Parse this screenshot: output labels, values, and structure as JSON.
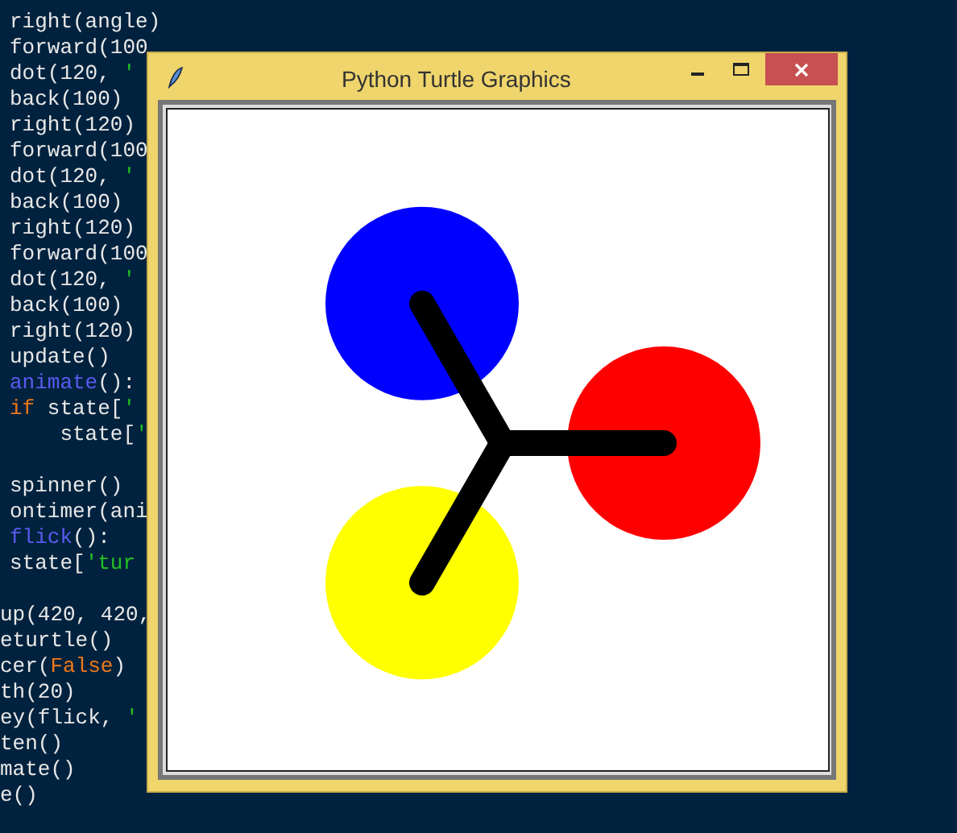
{
  "editor": {
    "lines": [
      {
        "kind": "code",
        "clipped": false,
        "segments": [
          {
            "kind": "plain",
            "text": "right(angle)"
          }
        ]
      },
      {
        "kind": "code",
        "clipped": false,
        "segments": [
          {
            "kind": "plain",
            "text": "forward(100"
          }
        ]
      },
      {
        "kind": "code",
        "clipped": false,
        "segments": [
          {
            "kind": "plain",
            "text": "dot(120, "
          },
          {
            "kind": "string",
            "text": "'"
          }
        ]
      },
      {
        "kind": "code",
        "clipped": false,
        "segments": [
          {
            "kind": "plain",
            "text": "back(100)"
          }
        ]
      },
      {
        "kind": "code",
        "clipped": false,
        "segments": [
          {
            "kind": "plain",
            "text": "right(120)"
          }
        ]
      },
      {
        "kind": "code",
        "clipped": false,
        "segments": [
          {
            "kind": "plain",
            "text": "forward(100"
          }
        ]
      },
      {
        "kind": "code",
        "clipped": false,
        "segments": [
          {
            "kind": "plain",
            "text": "dot(120, "
          },
          {
            "kind": "string",
            "text": "'"
          }
        ]
      },
      {
        "kind": "code",
        "clipped": false,
        "segments": [
          {
            "kind": "plain",
            "text": "back(100)"
          }
        ]
      },
      {
        "kind": "code",
        "clipped": false,
        "segments": [
          {
            "kind": "plain",
            "text": "right(120)"
          }
        ]
      },
      {
        "kind": "code",
        "clipped": false,
        "segments": [
          {
            "kind": "plain",
            "text": "forward(100"
          }
        ]
      },
      {
        "kind": "code",
        "clipped": false,
        "segments": [
          {
            "kind": "plain",
            "text": "dot(120, "
          },
          {
            "kind": "string",
            "text": "'"
          }
        ]
      },
      {
        "kind": "code",
        "clipped": false,
        "segments": [
          {
            "kind": "plain",
            "text": "back(100)"
          }
        ]
      },
      {
        "kind": "code",
        "clipped": false,
        "segments": [
          {
            "kind": "plain",
            "text": "right(120)"
          }
        ]
      },
      {
        "kind": "code",
        "clipped": false,
        "segments": [
          {
            "kind": "plain",
            "text": "update()"
          }
        ]
      },
      {
        "kind": "code",
        "clipped": false,
        "segments": [
          {
            "kind": "function",
            "text": "animate"
          },
          {
            "kind": "plain",
            "text": "():"
          }
        ]
      },
      {
        "kind": "code",
        "clipped": false,
        "segments": [
          {
            "kind": "keyword",
            "text": "if"
          },
          {
            "kind": "plain",
            "text": " state["
          },
          {
            "kind": "string",
            "text": "'"
          }
        ]
      },
      {
        "kind": "code",
        "clipped": false,
        "segments": [
          {
            "kind": "plain",
            "text": "    state["
          },
          {
            "kind": "string",
            "text": "'"
          }
        ]
      },
      {
        "kind": "blank"
      },
      {
        "kind": "code",
        "clipped": false,
        "segments": [
          {
            "kind": "plain",
            "text": "spinner()"
          }
        ]
      },
      {
        "kind": "code",
        "clipped": false,
        "segments": [
          {
            "kind": "plain",
            "text": "ontimer(ani"
          }
        ]
      },
      {
        "kind": "code",
        "clipped": false,
        "segments": [
          {
            "kind": "function",
            "text": "flick"
          },
          {
            "kind": "plain",
            "text": "():"
          }
        ]
      },
      {
        "kind": "code",
        "clipped": false,
        "segments": [
          {
            "kind": "plain",
            "text": "state["
          },
          {
            "kind": "string",
            "text": "'tur"
          }
        ]
      },
      {
        "kind": "blank"
      },
      {
        "kind": "code",
        "clipped": true,
        "segments": [
          {
            "kind": "plain",
            "text": "up(420, 420,"
          }
        ]
      },
      {
        "kind": "code",
        "clipped": true,
        "segments": [
          {
            "kind": "plain",
            "text": "eturtle()"
          }
        ]
      },
      {
        "kind": "code",
        "clipped": true,
        "segments": [
          {
            "kind": "plain",
            "text": "cer("
          },
          {
            "kind": "keyword",
            "text": "False"
          },
          {
            "kind": "plain",
            "text": ")"
          }
        ]
      },
      {
        "kind": "code",
        "clipped": true,
        "segments": [
          {
            "kind": "plain",
            "text": "th(20)"
          }
        ]
      },
      {
        "kind": "code",
        "clipped": true,
        "segments": [
          {
            "kind": "plain",
            "text": "ey(flick, "
          },
          {
            "kind": "string",
            "text": "'"
          }
        ]
      },
      {
        "kind": "code",
        "clipped": true,
        "segments": [
          {
            "kind": "plain",
            "text": "ten()"
          }
        ]
      },
      {
        "kind": "code",
        "clipped": true,
        "segments": [
          {
            "kind": "plain",
            "text": "mate()"
          }
        ]
      },
      {
        "kind": "code",
        "clipped": true,
        "segments": [
          {
            "kind": "plain",
            "text": "e()"
          }
        ]
      }
    ]
  },
  "window": {
    "title": "Python Turtle Graphics"
  },
  "canvas": {
    "dots": [
      {
        "color": "#ff0000"
      },
      {
        "color": "#ffff00"
      },
      {
        "color": "#0000ff"
      }
    ]
  }
}
